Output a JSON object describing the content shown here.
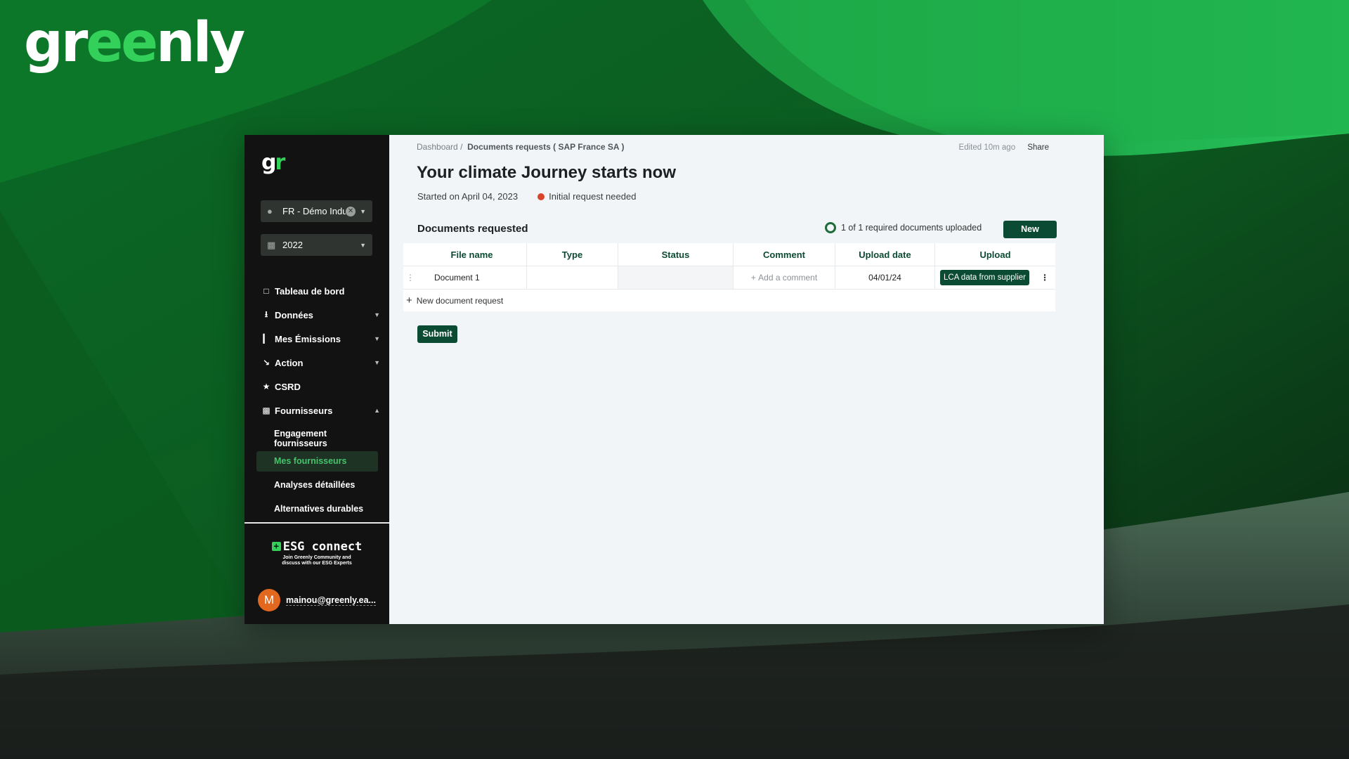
{
  "brand": {
    "wordmark_start": "gr",
    "wordmark_accent": "ee",
    "wordmark_end": "nly",
    "logo_icon": "greenly-logo"
  },
  "sidebar": {
    "logo_start": "g",
    "logo_accent": "r",
    "company_select": {
      "value": "FR - Démo Indu",
      "icon": "user-icon"
    },
    "year_select": {
      "value": "2022",
      "icon": "calendar-icon"
    },
    "nav": [
      {
        "label": "Tableau de bord",
        "icon": "square-icon"
      },
      {
        "label": "Données",
        "icon": "upload-icon"
      },
      {
        "label": "Mes Émissions",
        "icon": "bar-chart-icon"
      },
      {
        "label": "Action",
        "icon": "trend-down-icon"
      },
      {
        "label": "CSRD",
        "icon": "star-icon"
      },
      {
        "label": "Fournisseurs",
        "icon": "folder-icon"
      }
    ],
    "sub_nav": [
      {
        "label": "Engagement fournisseurs"
      },
      {
        "label": "Mes fournisseurs"
      },
      {
        "label": "Analyses détaillées"
      },
      {
        "label": "Alternatives durables"
      }
    ],
    "esg": {
      "title": "ESG connect",
      "subtitle_line1": "Join Greenly Community and",
      "subtitle_line2": "discuss with our ESG Experts"
    },
    "user": {
      "initial": "M",
      "email": "mainou@greenly.ea..."
    }
  },
  "main": {
    "breadcrumb": {
      "root": "Dashboard",
      "separator": "/",
      "current": "Documents requests ( SAP France SA )"
    },
    "edited": "Edited 10m ago",
    "share": "Share",
    "title": "Your climate Journey starts now",
    "started": "Started on April 04, 2023",
    "status": "Initial request needed",
    "section_title": "Documents requested",
    "progress_text": "1 of 1 required documents uploaded",
    "new_button": "New",
    "table": {
      "columns": [
        "File name",
        "Type",
        "Status",
        "Comment",
        "Upload date",
        "Upload"
      ],
      "rows": [
        {
          "file_name": "Document 1",
          "type": "",
          "status": "",
          "comment_placeholder": "Add a comment",
          "upload_date": "04/01/24",
          "upload_tag": "LCA data from supplier"
        }
      ],
      "new_request": "New document request"
    },
    "submit_button": "Submit"
  },
  "colors": {
    "accent": "#0c4b33",
    "brand_green": "#33d05a",
    "status_red": "#d8432a",
    "sidebar_bg": "#121212"
  }
}
